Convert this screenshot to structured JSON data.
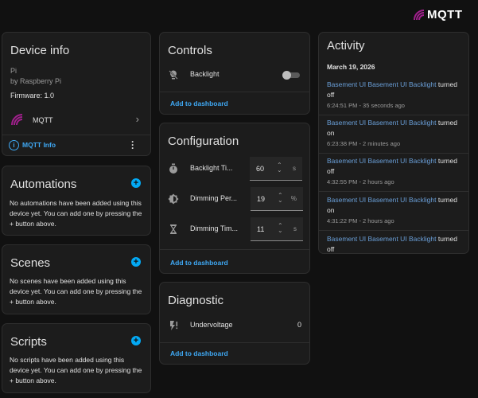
{
  "brand": {
    "name": "MQTT"
  },
  "device_info": {
    "title": "Device info",
    "model": "Pi",
    "manufacturer": "by Raspberry Pi",
    "firmware": "Firmware: 1.0",
    "integration": "MQTT",
    "info_link": "MQTT Info"
  },
  "automations": {
    "title": "Automations",
    "text": "No automations have been added using this device yet. You can add one by pressing the + button above."
  },
  "scenes": {
    "title": "Scenes",
    "text": "No scenes have been added using this device yet. You can add one by pressing the + button above."
  },
  "scripts": {
    "title": "Scripts",
    "text": "No scripts have been added using this device yet. You can add one by pressing the + button above."
  },
  "controls": {
    "title": "Controls",
    "entity": "Backlight",
    "toggle_on": false,
    "add_label": "Add to dashboard"
  },
  "configuration": {
    "title": "Configuration",
    "rows": [
      {
        "name": "Backlight Ti...",
        "value": "60",
        "unit": "s"
      },
      {
        "name": "Dimming Per...",
        "value": "19",
        "unit": "%"
      },
      {
        "name": "Dimming Tim...",
        "value": "11",
        "unit": "s"
      }
    ],
    "add_label": "Add to dashboard"
  },
  "diagnostic": {
    "title": "Diagnostic",
    "entity": "Undervoltage",
    "value": "0",
    "add_label": "Add to dashboard"
  },
  "activity": {
    "title": "Activity",
    "date": "March 19, 2026",
    "items": [
      {
        "entity": "Basement UI Basement UI Backlight",
        "action": "turned",
        "state": "off",
        "time": "6:24:51 PM - 35 seconds ago"
      },
      {
        "entity": "Basement UI Basement UI Backlight",
        "action": "turned",
        "state": "on",
        "time": "6:23:38 PM - 2 minutes ago"
      },
      {
        "entity": "Basement UI Basement UI Backlight",
        "action": "turned",
        "state": "off",
        "time": "4:32:55 PM - 2 hours ago"
      },
      {
        "entity": "Basement UI Basement UI Backlight",
        "action": "turned",
        "state": "on",
        "time": "4:31:22 PM - 2 hours ago"
      },
      {
        "entity": "Basement UI Basement UI Backlight",
        "action": "turned",
        "state": "off",
        "time": ""
      }
    ]
  },
  "colors": {
    "accent": "#03a9f4",
    "link": "#3fa9f5",
    "brand": "#a0208c"
  }
}
